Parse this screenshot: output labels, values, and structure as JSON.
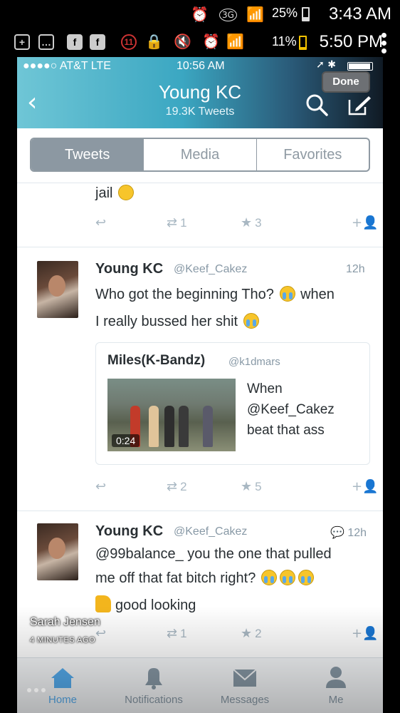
{
  "android_status": {
    "battery": "25%",
    "time": "3:43 AM",
    "network_badge": "3G"
  },
  "android_status2": {
    "notif_count": "11",
    "battery": "11%",
    "time": "5:50 PM"
  },
  "ios_status": {
    "carrier": "●●●●○ AT&T  LTE",
    "time": "10:56 AM"
  },
  "header": {
    "name": "Young KC",
    "tweet_count": "19.3K Tweets",
    "done_label": "Done",
    "back_icon": "chevron-left-icon",
    "search_icon": "search-icon",
    "compose_icon": "compose-icon"
  },
  "tabs": [
    "Tweets",
    "Media",
    "Favorites"
  ],
  "tweets": [
    {
      "text": "jail",
      "retweets": "1",
      "favorites": "3"
    },
    {
      "name": "Young KC",
      "handle": "@Keef_Cakez",
      "time": "12h",
      "text1": "Who got the beginning Tho?",
      "text2": "when",
      "text3": "I really bussed her shit",
      "quote": {
        "name": "Miles(K-Bandz)",
        "handle": "@k1dmars",
        "text": "When @Keef_Cakez beat that ass",
        "duration": "0:24"
      },
      "retweets": "2",
      "favorites": "5"
    },
    {
      "name": "Young KC",
      "handle": "@Keef_Cakez",
      "time": "12h",
      "text1": "@99balance_ you the one that pulled",
      "text2": "me off that fat bitch right?",
      "text3": "good looking",
      "retweets": "1",
      "favorites": "2"
    }
  ],
  "tabbar": [
    "Home",
    "Notifications",
    "Messages",
    "Me"
  ],
  "overlay": {
    "name": "Sarah Jensen",
    "sub": "4 MINUTES AGO"
  },
  "colors": {
    "accent": "#55acee",
    "icon_grey": "#a9b8c3",
    "header_start": "#6fc6d6",
    "header_end": "#101a24"
  }
}
